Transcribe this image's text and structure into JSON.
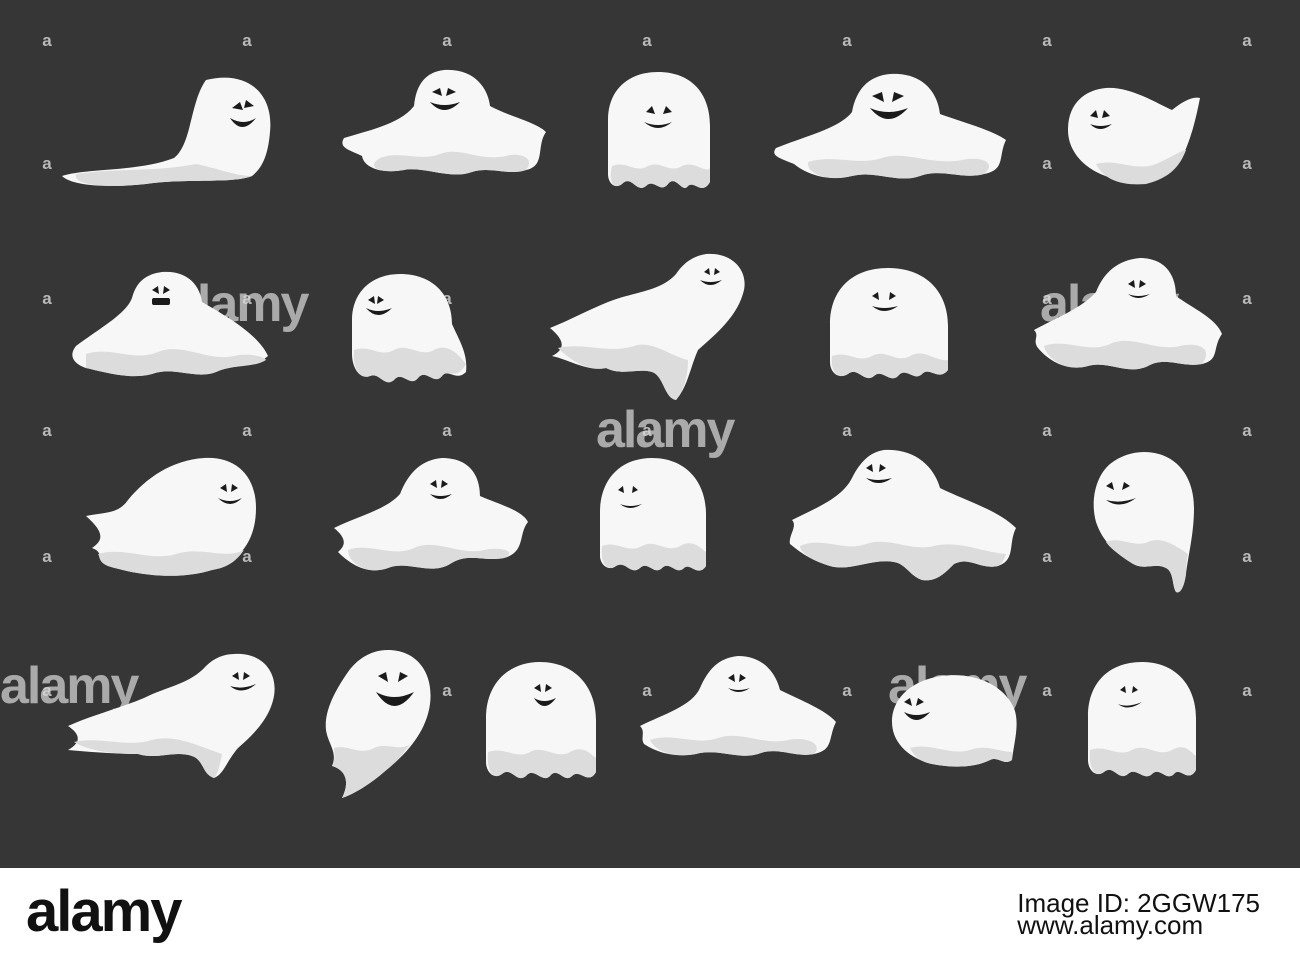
{
  "colors": {
    "background": "#363636",
    "ghost_fill": "#f7f7f7",
    "ghost_shade": "#dcdcdc",
    "face": "#1b1b1b"
  },
  "watermark": {
    "word": "alamy",
    "letter": "a"
  },
  "ghosts": {
    "count": 22,
    "icon": "ghost-icon"
  },
  "footer": {
    "logo": "alamy",
    "image_id_label": "Image ID: 2GGW175",
    "site": "www.alamy.com"
  }
}
